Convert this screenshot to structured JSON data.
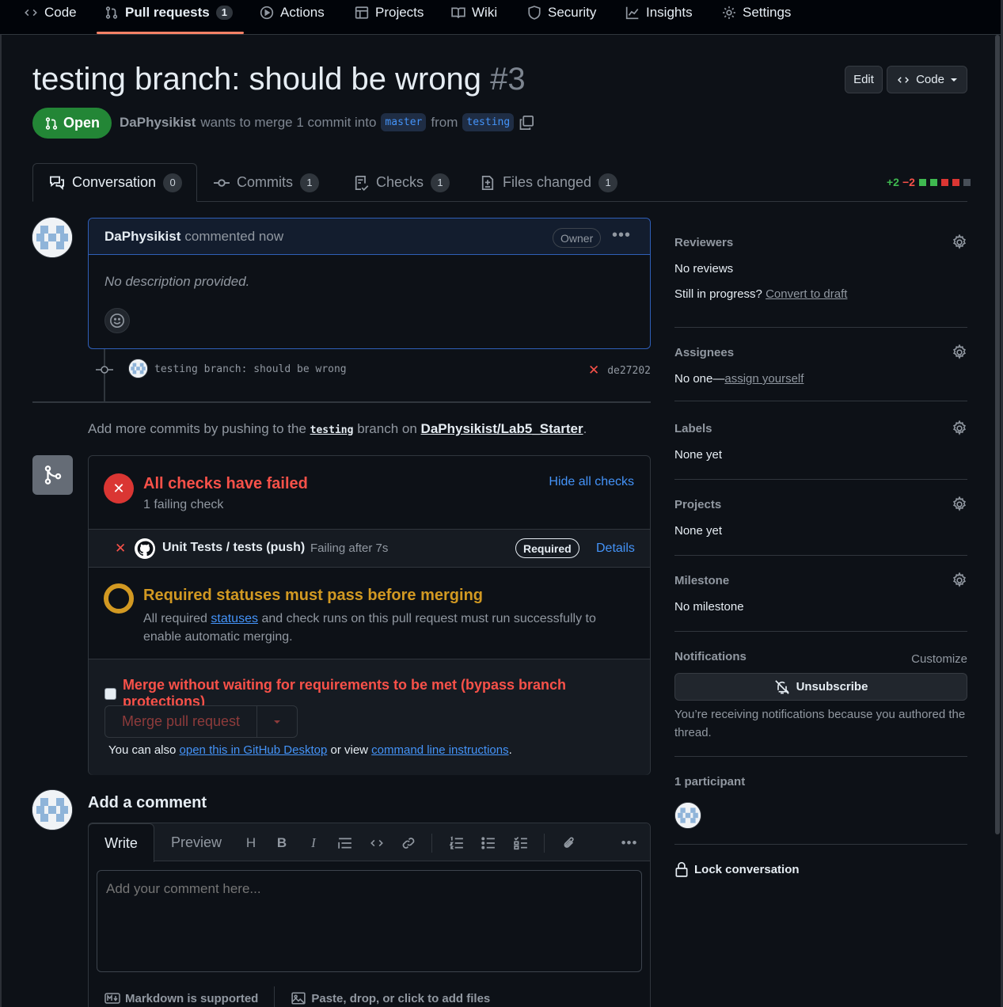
{
  "repo_nav": {
    "items": [
      {
        "label": "Code"
      },
      {
        "label": "Pull requests",
        "count": "1"
      },
      {
        "label": "Actions"
      },
      {
        "label": "Projects"
      },
      {
        "label": "Wiki"
      },
      {
        "label": "Security"
      },
      {
        "label": "Insights"
      },
      {
        "label": "Settings"
      }
    ]
  },
  "header": {
    "title": "testing branch: should be wrong",
    "number": "#3",
    "edit_label": "Edit",
    "code_label": "Code",
    "state": "Open",
    "author": "DaPhysikist",
    "merge_text": "wants to merge 1 commit into",
    "base_branch": "master",
    "from_text": "from",
    "head_branch": "testing"
  },
  "tabs": [
    {
      "label": "Conversation",
      "count": "0"
    },
    {
      "label": "Commits",
      "count": "1"
    },
    {
      "label": "Checks",
      "count": "1"
    },
    {
      "label": "Files changed",
      "count": "1"
    }
  ],
  "diffstat": {
    "additions": "+2",
    "deletions": "−2",
    "colors": {
      "add": "#3fb950",
      "del": "#f85149"
    }
  },
  "comment": {
    "author": "DaPhysikist",
    "action": "commented now",
    "badge": "Owner",
    "body": "No description provided."
  },
  "commit": {
    "message": "testing branch: should be wrong",
    "sha": "de27202"
  },
  "push_hint": {
    "prefix": "Add more commits by pushing to the",
    "branch": "testing",
    "middle": "branch on",
    "repo": "DaPhysikist/Lab5_Starter",
    "suffix": "."
  },
  "merge_box": {
    "checks_title": "All checks have failed",
    "checks_sub": "1 failing check",
    "hide_label": "Hide all checks",
    "check_name": "Unit Tests / tests (push)",
    "check_status": "Failing after 7s",
    "required_badge": "Required",
    "details_label": "Details",
    "req_title": "Required statuses must pass before merging",
    "req_desc_1": "All required",
    "req_desc_link": "statuses",
    "req_desc_2": "and check runs on this pull request must run successfully to enable automatic merging.",
    "bypass_label": "Merge without waiting for requirements to be met (bypass branch protections)",
    "merge_label": "Merge pull request",
    "also_1": "You can also",
    "also_link1": "open this in GitHub Desktop",
    "also_2": "or view",
    "also_link2": "command line instructions",
    "also_3": "."
  },
  "add_comment": {
    "title": "Add a comment",
    "tab_write": "Write",
    "tab_preview": "Preview",
    "placeholder": "Add your comment here...",
    "markdown_label": "Markdown is supported",
    "files_label": "Paste, drop, or click to add files"
  },
  "sidebar": {
    "reviewers": {
      "title": "Reviewers",
      "value": "No reviews",
      "progress_text": "Still in progress?",
      "draft_link": "Convert to draft"
    },
    "assignees": {
      "title": "Assignees",
      "value": "No one—",
      "assign_link": "assign yourself"
    },
    "labels": {
      "title": "Labels",
      "value": "None yet"
    },
    "projects": {
      "title": "Projects",
      "value": "None yet"
    },
    "milestone": {
      "title": "Milestone",
      "value": "No milestone"
    },
    "notifications": {
      "title": "Notifications",
      "customize": "Customize",
      "button": "Unsubscribe",
      "reason": "You’re receiving notifications because you authored the thread."
    },
    "participants": {
      "title": "1 participant"
    },
    "lock": "Lock conversation"
  }
}
